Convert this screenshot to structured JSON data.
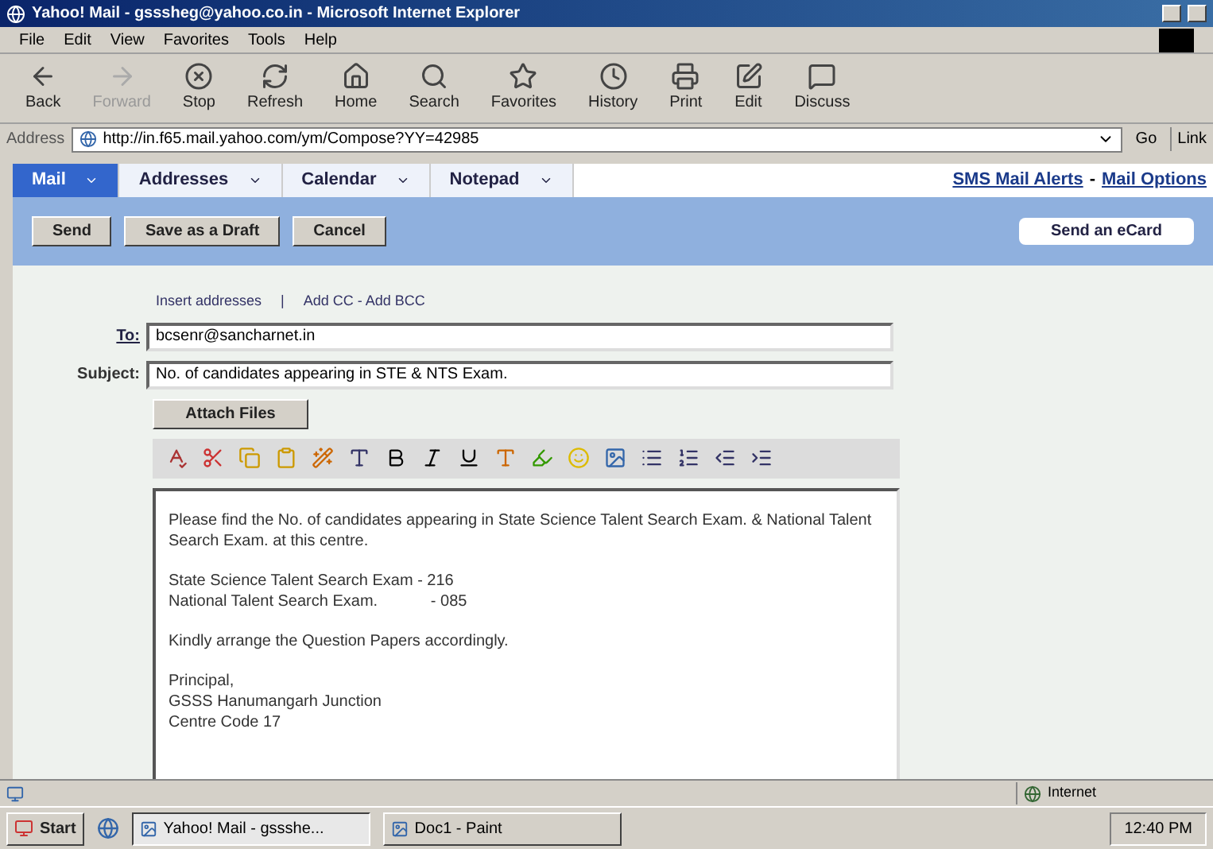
{
  "window": {
    "title": "Yahoo! Mail - gsssheg@yahoo.co.in - Microsoft Internet Explorer"
  },
  "menu": [
    "File",
    "Edit",
    "View",
    "Favorites",
    "Tools",
    "Help"
  ],
  "toolbar": [
    {
      "kind": "back",
      "label": "Back",
      "disabled": false
    },
    {
      "kind": "forward",
      "label": "Forward",
      "disabled": true
    },
    {
      "kind": "stop",
      "label": "Stop",
      "disabled": false
    },
    {
      "kind": "refresh",
      "label": "Refresh",
      "disabled": false
    },
    {
      "kind": "home",
      "label": "Home",
      "disabled": false
    },
    {
      "kind": "search",
      "label": "Search",
      "disabled": false
    },
    {
      "kind": "favorites",
      "label": "Favorites",
      "disabled": false
    },
    {
      "kind": "history",
      "label": "History",
      "disabled": false
    },
    {
      "kind": "print",
      "label": "Print",
      "disabled": false
    },
    {
      "kind": "edit",
      "label": "Edit",
      "disabled": false
    },
    {
      "kind": "discuss",
      "label": "Discuss",
      "disabled": false
    }
  ],
  "address_bar": {
    "label": "Address",
    "value": "http://in.f65.mail.yahoo.com/ym/Compose?YY=42985",
    "go": "Go",
    "links": "Link"
  },
  "tabs": [
    {
      "label": "Mail",
      "selected": true
    },
    {
      "label": "Addresses",
      "selected": false
    },
    {
      "label": "Calendar",
      "selected": false
    },
    {
      "label": "Notepad",
      "selected": false
    }
  ],
  "top_links": [
    "SMS Mail Alerts",
    "-",
    "Mail Options"
  ],
  "actions": [
    "Send",
    "Save as a Draft",
    "Cancel"
  ],
  "ecard_button": "Send an eCard",
  "address_links": [
    "Insert addresses",
    "|",
    "Add CC - Add BCC"
  ],
  "to": {
    "label": "To:",
    "value": "bcsenr@sancharnet.in"
  },
  "subject": {
    "label": "Subject:",
    "value": "No. of candidates appearing in STE & NTS Exam."
  },
  "attach_button": "Attach Files",
  "body": [
    [
      "Please find the No. of candidates appearing in State Science Talent Search Exam. & National Talent Search Exam. at this centre."
    ],
    [
      "State Science Talent Search Exam - 216",
      "National Talent Search Exam.            - 085"
    ],
    [
      "Kindly arrange the Question Papers accordingly."
    ],
    [
      "Principal,",
      "GSSS Hanumangarh Junction",
      "Centre Code 17"
    ]
  ],
  "status_bar": {
    "zone": "Internet"
  },
  "taskbar": {
    "start": "Start",
    "tasks": [
      {
        "label": "Yahoo! Mail - gssshe...",
        "selected": true
      },
      {
        "label": "Doc1 - Paint",
        "selected": false
      }
    ],
    "clock": "12:40 PM"
  }
}
